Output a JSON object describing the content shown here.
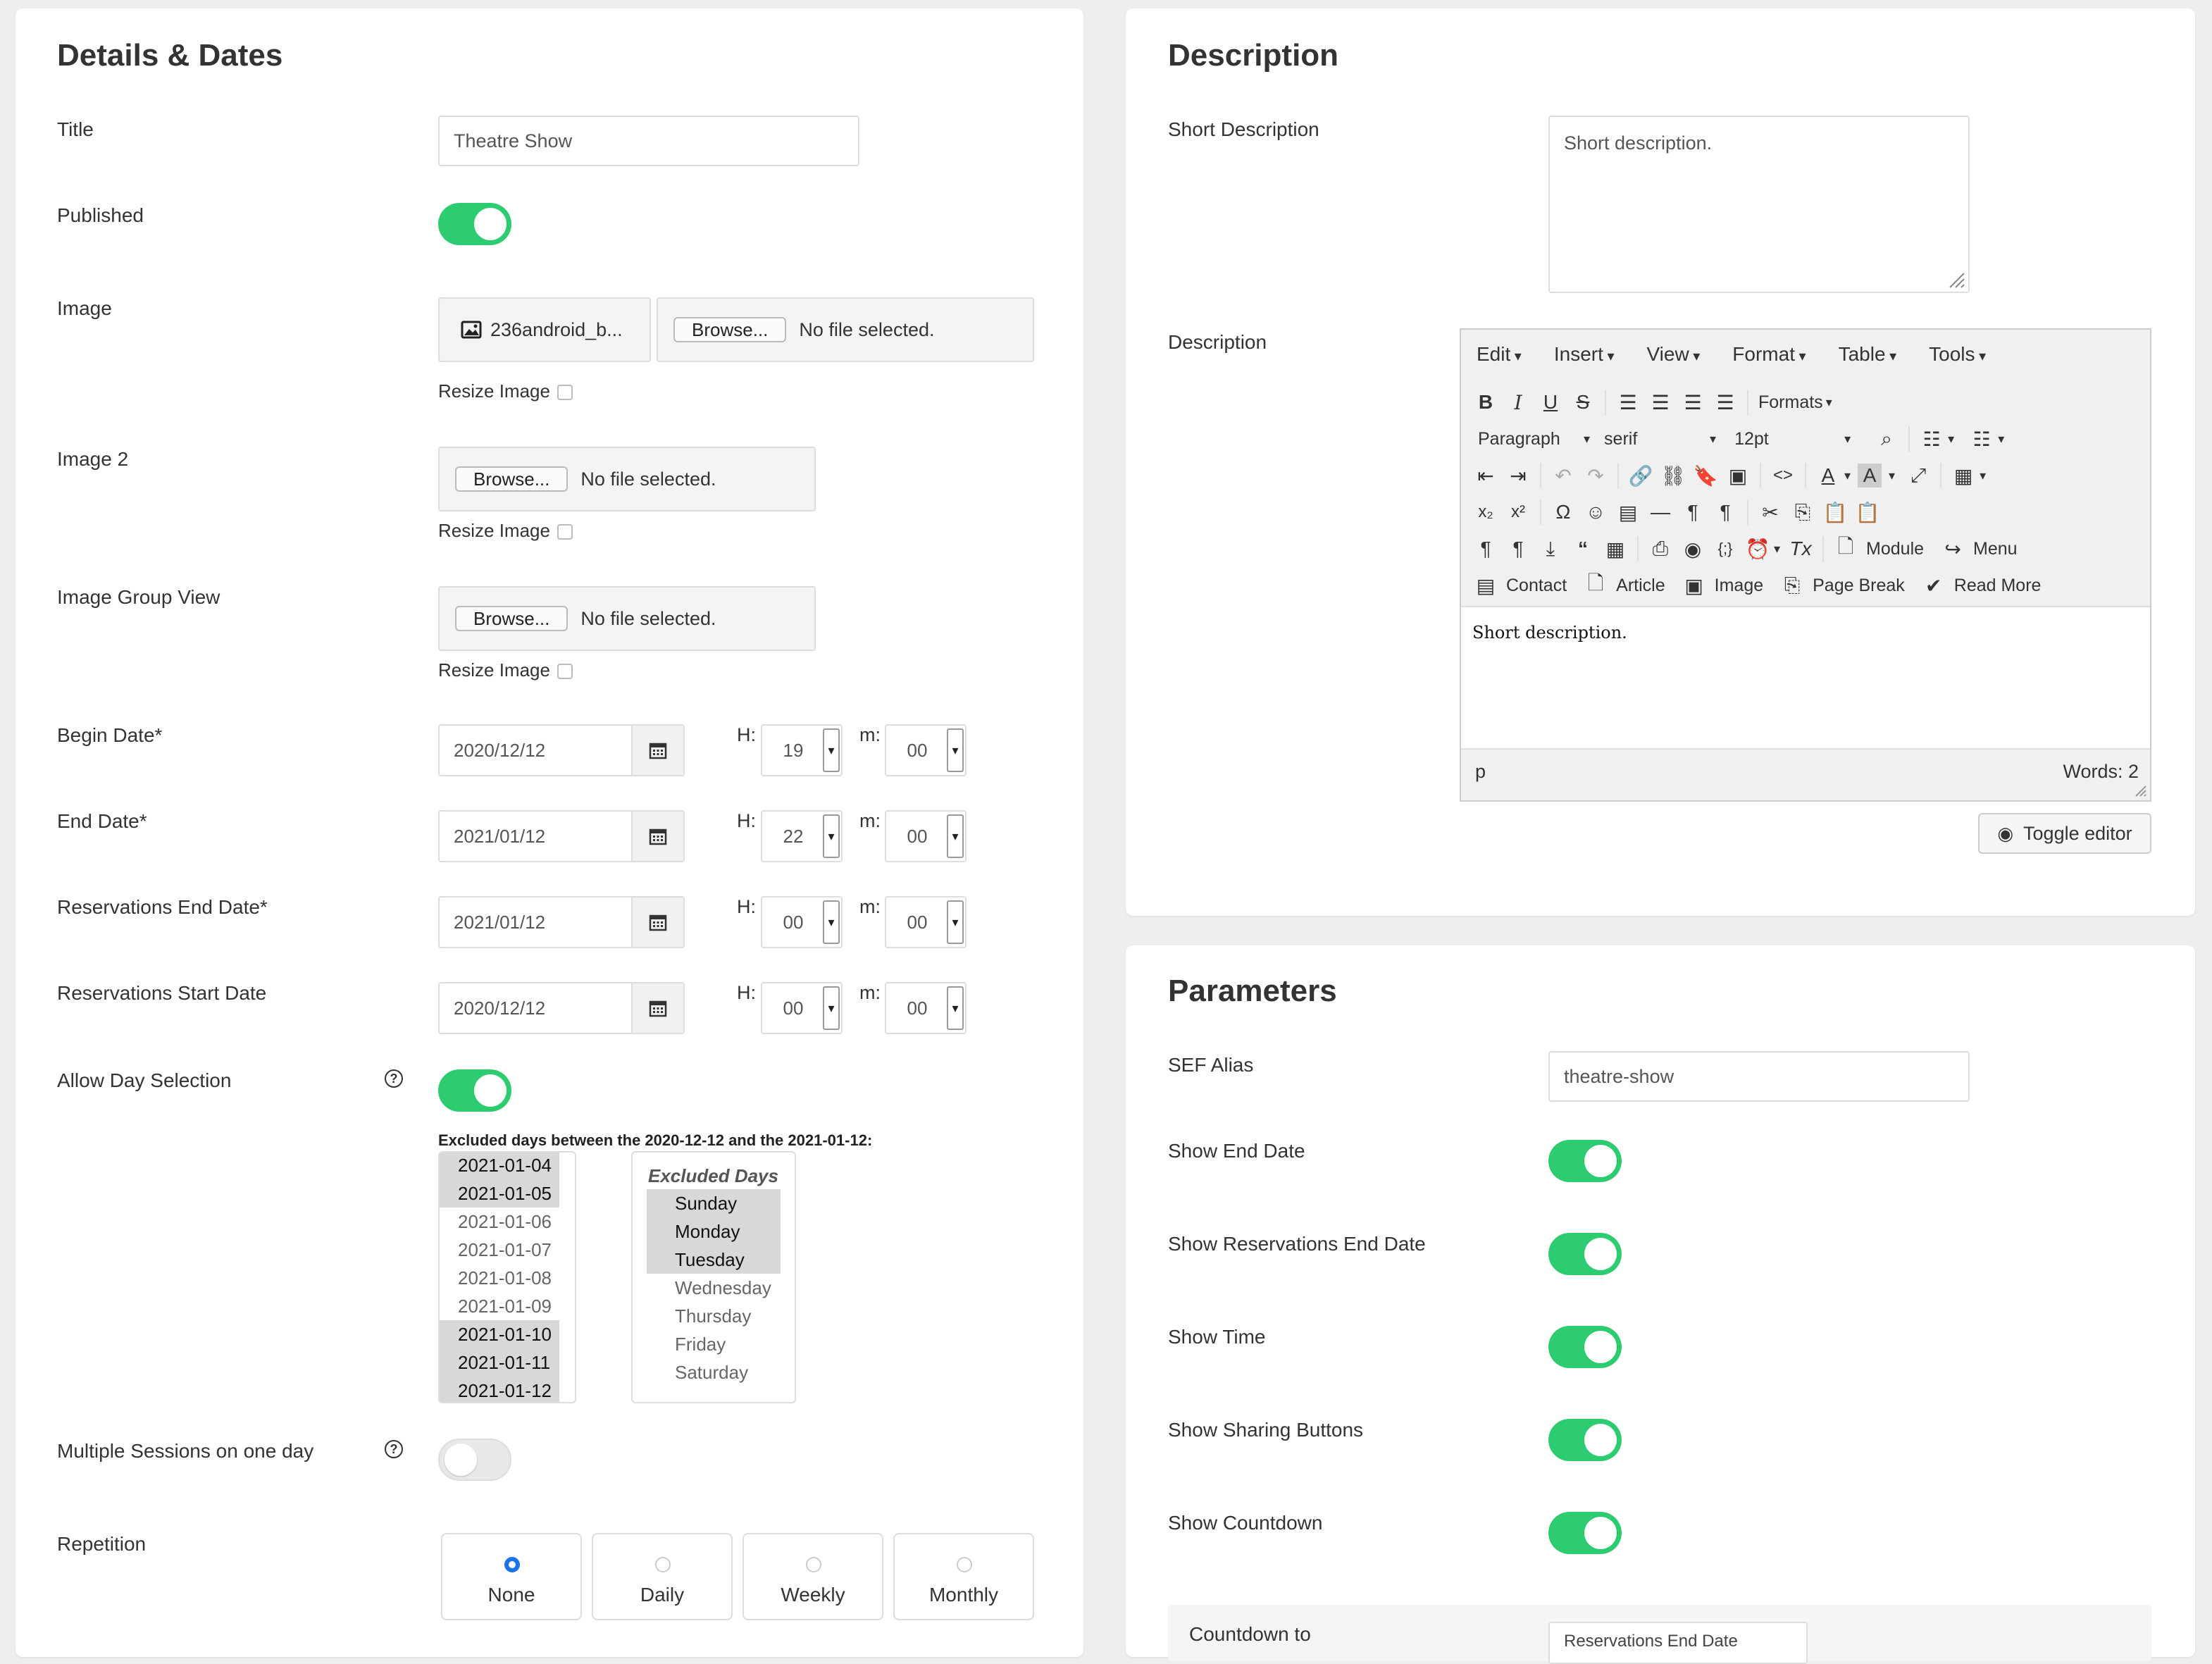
{
  "details": {
    "heading": "Details & Dates",
    "title": {
      "label": "Title",
      "value": "Theatre Show"
    },
    "published": {
      "label": "Published",
      "on": true
    },
    "image": {
      "label": "Image",
      "current": "236android_b...",
      "browse": "Browse...",
      "no_file": "No file selected.",
      "resize": "Resize Image"
    },
    "image2": {
      "label": "Image 2",
      "browse": "Browse...",
      "no_file": "No file selected.",
      "resize": "Resize Image"
    },
    "image_group": {
      "label": "Image Group View",
      "browse": "Browse...",
      "no_file": "No file selected.",
      "resize": "Resize Image"
    },
    "hour_label": "H:",
    "minute_label": "m:",
    "dates": [
      {
        "label": "Begin Date*",
        "date": "2020/12/12",
        "hour": "19",
        "minute": "00"
      },
      {
        "label": "End Date*",
        "date": "2021/01/12",
        "hour": "22",
        "minute": "00"
      },
      {
        "label": "Reservations End Date*",
        "date": "2021/01/12",
        "hour": "00",
        "minute": "00"
      },
      {
        "label": "Reservations Start Date",
        "date": "2020/12/12",
        "hour": "00",
        "minute": "00"
      }
    ],
    "allow_day_selection": {
      "label": "Allow Day Selection",
      "help": "?",
      "on": true
    },
    "excluded_caption": "Excluded days between the 2020-12-12 and the 2021-01-12:",
    "excluded_dates": [
      {
        "date": "2021-01-04",
        "selected": true
      },
      {
        "date": "2021-01-05",
        "selected": true
      },
      {
        "date": "2021-01-06",
        "selected": false
      },
      {
        "date": "2021-01-07",
        "selected": false
      },
      {
        "date": "2021-01-08",
        "selected": false
      },
      {
        "date": "2021-01-09",
        "selected": false
      },
      {
        "date": "2021-01-10",
        "selected": true
      },
      {
        "date": "2021-01-11",
        "selected": true
      },
      {
        "date": "2021-01-12",
        "selected": true
      }
    ],
    "excluded_days_title": "Excluded Days",
    "excluded_days": [
      {
        "day": "Sunday",
        "selected": true
      },
      {
        "day": "Monday",
        "selected": true
      },
      {
        "day": "Tuesday",
        "selected": true
      },
      {
        "day": "Wednesday",
        "selected": false
      },
      {
        "day": "Thursday",
        "selected": false
      },
      {
        "day": "Friday",
        "selected": false
      },
      {
        "day": "Saturday",
        "selected": false
      }
    ],
    "multiple_sessions": {
      "label": "Multiple Sessions on one day",
      "help": "?",
      "on": false
    },
    "repetition": {
      "label": "Repetition",
      "options": [
        {
          "label": "None",
          "checked": true
        },
        {
          "label": "Daily",
          "checked": false
        },
        {
          "label": "Weekly",
          "checked": false
        },
        {
          "label": "Monthly",
          "checked": false
        }
      ]
    }
  },
  "description": {
    "heading": "Description",
    "short_label": "Short Description",
    "short_value": "Short description.",
    "desc_label": "Description",
    "menu": [
      "Edit",
      "Insert",
      "View",
      "Format",
      "Table",
      "Tools"
    ],
    "formats_label": "Formats",
    "block_select": "Paragraph",
    "font_select": "serif",
    "size_select": "12pt",
    "btn_module": "Module",
    "btn_menu": "Menu",
    "btn_contact": "Contact",
    "btn_article": "Article",
    "btn_image": "Image",
    "btn_pagebreak": "Page Break",
    "btn_readmore": "Read More",
    "content": "Short description.",
    "status_path": "p",
    "word_count": "Words: 2",
    "toggle_editor": "Toggle editor"
  },
  "parameters": {
    "heading": "Parameters",
    "sef_label": "SEF Alias",
    "sef_value": "theatre-show",
    "switches": [
      {
        "label": "Show End Date",
        "on": true
      },
      {
        "label": "Show Reservations End Date",
        "on": true
      },
      {
        "label": "Show Time",
        "on": true
      },
      {
        "label": "Show Sharing Buttons",
        "on": true
      },
      {
        "label": "Show Countdown",
        "on": true
      }
    ],
    "countdown_label": "Countdown to",
    "countdown_value": "Reservations End Date"
  }
}
